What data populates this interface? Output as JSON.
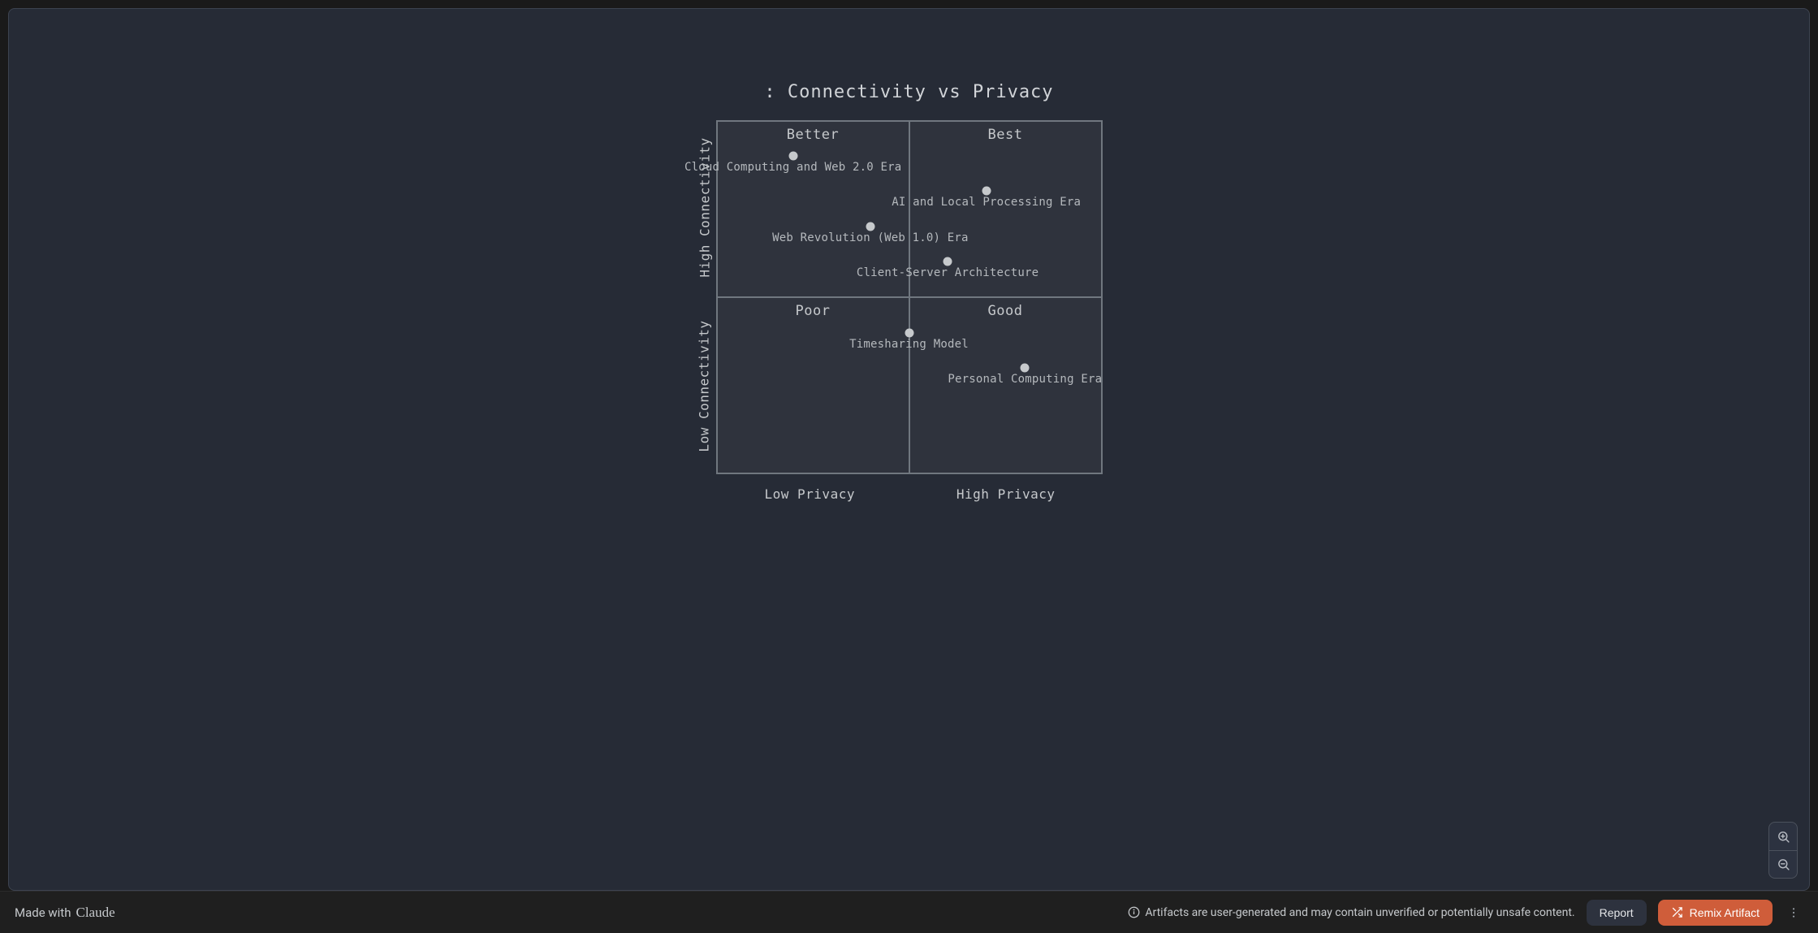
{
  "chart_data": {
    "type": "scatter",
    "title": ": Connectivity vs Privacy",
    "xlabel": "Privacy",
    "ylabel": "Connectivity",
    "x_axis": {
      "low": "Low Privacy",
      "high": "High Privacy"
    },
    "y_axis": {
      "low": "Low Connectivity",
      "high": "High Connectivity"
    },
    "quadrants": {
      "top_left": "Better",
      "top_right": "Best",
      "bottom_left": "Poor",
      "bottom_right": "Good"
    },
    "xlim": [
      0,
      10
    ],
    "ylim": [
      0,
      10
    ],
    "points": [
      {
        "name": "Cloud Computing and Web 2.0 Era",
        "x": 2.0,
        "y": 9.0
      },
      {
        "name": "AI and Local Processing Era",
        "x": 7.0,
        "y": 8.0
      },
      {
        "name": "Web Revolution (Web 1.0) Era",
        "x": 4.0,
        "y": 7.0
      },
      {
        "name": "Client-Server Architecture",
        "x": 6.0,
        "y": 6.0
      },
      {
        "name": "Timesharing Model",
        "x": 5.0,
        "y": 4.0
      },
      {
        "name": "Personal Computing Era",
        "x": 8.0,
        "y": 3.0
      }
    ]
  },
  "footer": {
    "made_with_prefix": "Made with",
    "made_with_brand": "Claude",
    "warning": "Artifacts are user-generated and may contain unverified or potentially unsafe content.",
    "report": "Report",
    "remix": "Remix Artifact"
  }
}
